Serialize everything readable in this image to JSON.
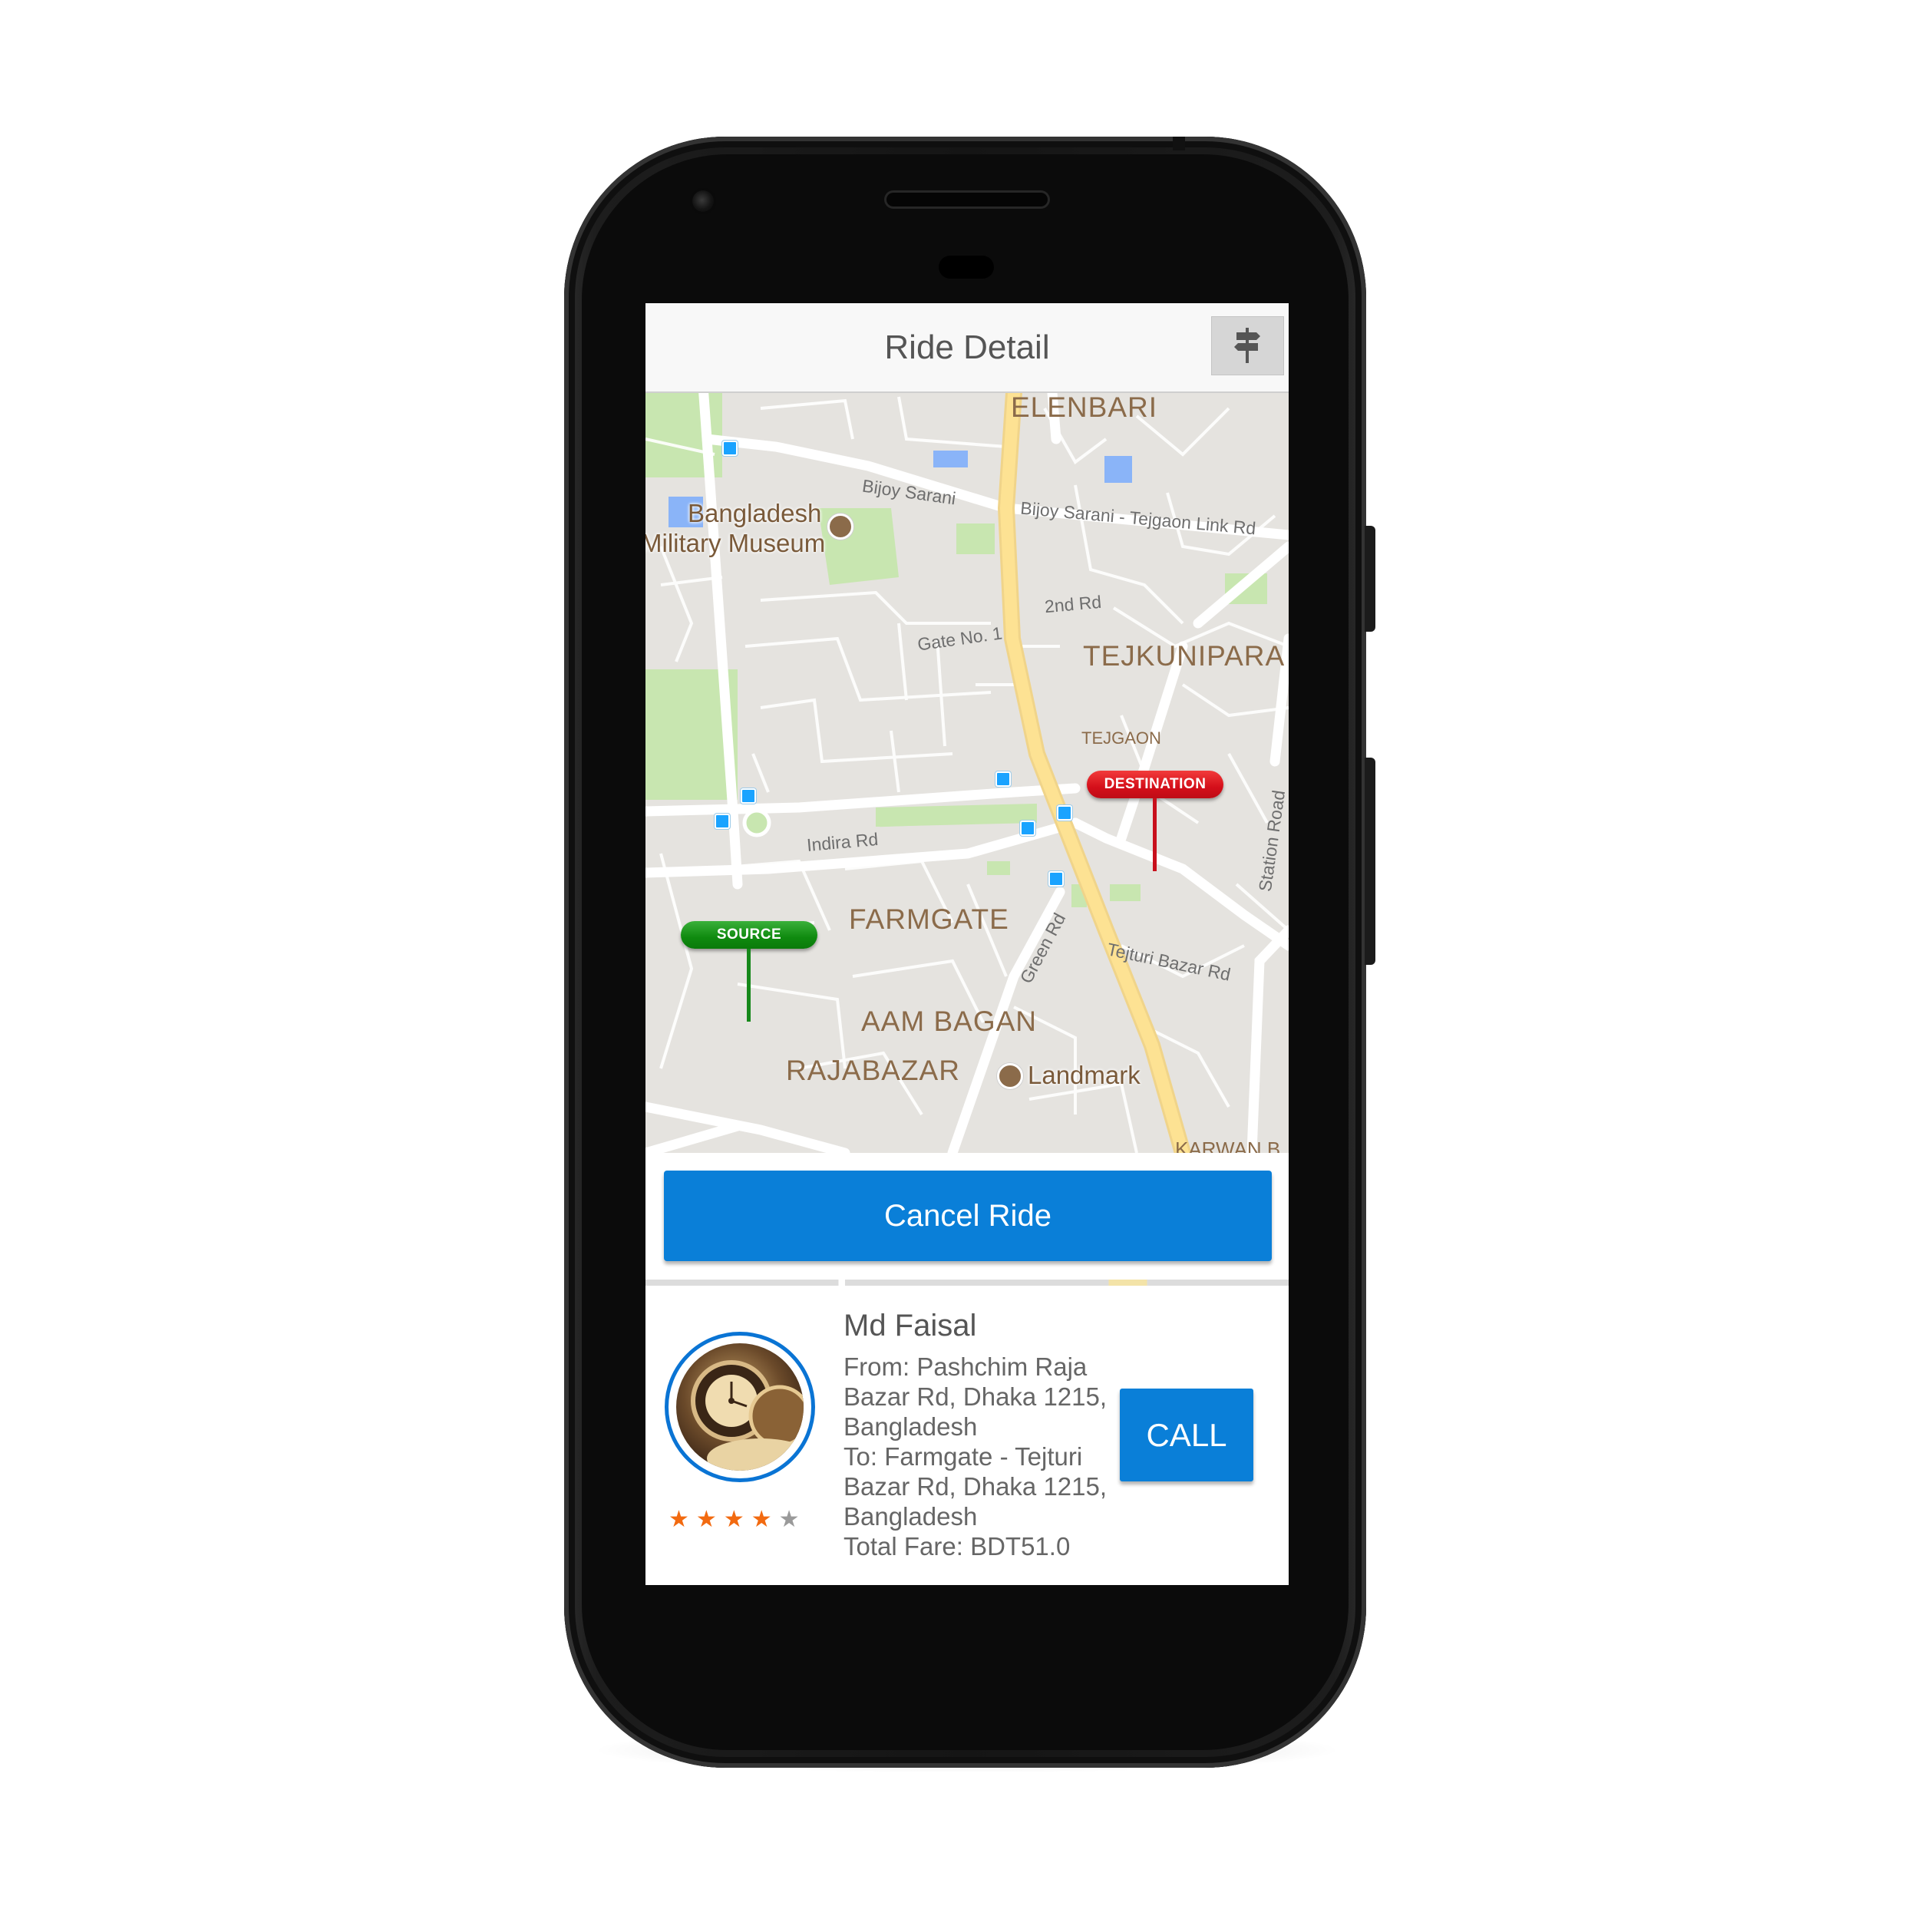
{
  "header": {
    "title": "Ride Detail",
    "route_icon": "signpost-icon"
  },
  "map": {
    "areas": {
      "elenbari": "ELENBARI",
      "tejkunipara": "TEJKUNIPARA",
      "tejgaon": "TEJGAON",
      "farmgate": "FARMGATE",
      "aam_bagan": "AAM BAGAN",
      "rajabazar": "RAJABAZAR",
      "karwan": "KARWAN B"
    },
    "roads": {
      "bijoy_sarani": "Bijoy Sarani",
      "bijoy_tejgaon_link": "Bijoy Sarani - Tejgaon Link Rd",
      "second_rd": "2nd Rd",
      "gate_no_1": "Gate No. 1",
      "indira_rd": "Indira Rd",
      "green_rd": "Green Rd",
      "tejturi_bazar_rd": "Tejturi Bazar Rd",
      "station_road": "Station Road"
    },
    "pois": {
      "museum_line1": "Bangladesh",
      "museum_line2": "Military Museum",
      "landmark": "Landmark"
    },
    "markers": {
      "source": "SOURCE",
      "destination": "DESTINATION"
    },
    "colors": {
      "source": "#0f8a0f",
      "destination": "#d40f1a",
      "highway": "#fde293",
      "park": "#c8e6b0",
      "water": "#8ab4f8"
    }
  },
  "actions": {
    "cancel_label": "Cancel Ride",
    "call_label": "CALL"
  },
  "driver": {
    "name": "Md Faisal",
    "from": "From: Pashchim Raja Bazar Rd, Dhaka 1215, Bangladesh",
    "to": "To: Farmgate - Tejturi Bazar Rd, Dhaka 1215, Bangladesh",
    "fare": "Total Fare: BDT51.0",
    "rating": 4,
    "rating_max": 5
  },
  "colors": {
    "accent": "#0a7fd8",
    "star": "#f26a10"
  }
}
